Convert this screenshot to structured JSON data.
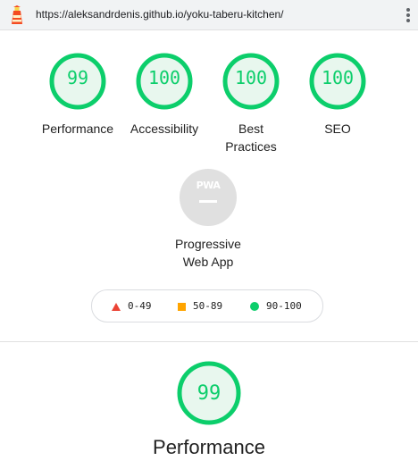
{
  "browser": {
    "url": "https://aleksandrdenis.github.io/yoku-taberu-kitchen/"
  },
  "categories": [
    {
      "label": "Performance",
      "score": "99"
    },
    {
      "label": "Accessibility",
      "score": "100"
    },
    {
      "label": "Best Practices",
      "score": "100"
    },
    {
      "label": "SEO",
      "score": "100"
    }
  ],
  "pwa": {
    "badge_text": "PWA",
    "label": "Progressive Web App"
  },
  "legend": {
    "fail": "0-49",
    "average": "50-89",
    "pass": "90-100"
  },
  "section": {
    "score": "99",
    "title": "Performance"
  },
  "colors": {
    "pass": "#0cce6b",
    "pass_fill": "#e8f7ee",
    "average": "#ffa400",
    "fail": "#eb4335",
    "pwa_gray": "#e0e0e0"
  },
  "icons": {
    "logo": "lighthouse-icon",
    "menu": "more-vert-icon"
  }
}
